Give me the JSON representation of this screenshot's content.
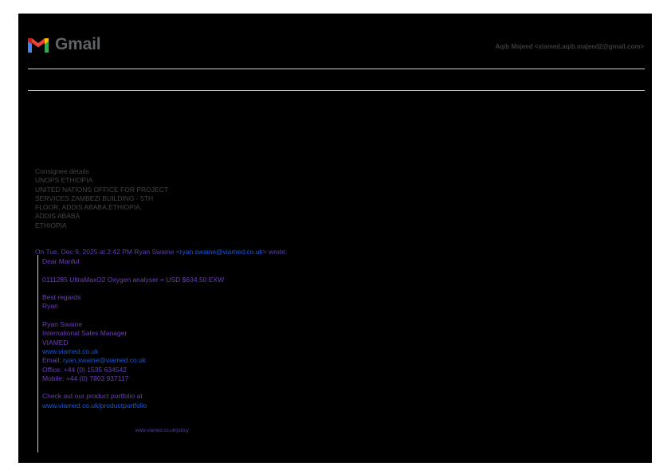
{
  "header": {
    "logo_text": "Gmail",
    "account": "Aqib Majeed <viamed.aqib.majeed2@gmail.com>"
  },
  "consignee": {
    "lines": [
      "Consignee details",
      "UNOPS ETHIOPIA",
      "UNITED NATIONS OFFICE FOR PROJECT",
      "SERVICES ZAMBEZI BUILDING - 5TH",
      "FLOOR, ADDIS ABABA,ETHIOPIA.",
      "ADDIS ABABA",
      "ETHIOPIA"
    ]
  },
  "quote": {
    "header_prefix": "On Tue, Dec 9, 2025 at 2:42 PM Ryan Swaine <",
    "header_email": "ryan.swaine@viamed.co.uk",
    "header_suffix": "> wrote:",
    "greeting": "Dear Manful",
    "item": "0111285 UltraMaxO2 Oxygen analyser = USD $634.50 EXW",
    "regards": "Best regards",
    "regards_name": "Ryan",
    "sig_name": "Ryan Swaine",
    "sig_title": "International Sales Manager",
    "sig_company": "VIAMED",
    "sig_website": "www.viamed.co.uk",
    "email_label": "Email: ",
    "email_value": "ryan.swaine@viamed.co.uk",
    "office": "Office: +44 (0) 1535 634542",
    "mobile": "Mobile: +44 (0) 7803 937117",
    "portfolio_text": "Check out our product portfolio at",
    "portfolio_link": "www.viamed.co.uk/productportfolio",
    "footer_link": "www.viamed.co.uk/policy"
  }
}
